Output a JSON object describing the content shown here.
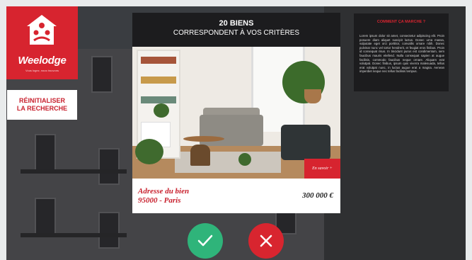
{
  "brand": {
    "name": "Weelodge",
    "tagline": "Vous logez, nous trouvons",
    "accent_color": "#d7242f",
    "house_icon": "house-people-icon"
  },
  "sidebar": {
    "reset_button": {
      "line1": "RÉINITIALISER",
      "line2": "LA RECHERCHE"
    }
  },
  "results": {
    "count_line": "20 BIENS",
    "criteria_line": "CORRESPONDENT À VOS CRITÈRES"
  },
  "listing": {
    "address_line1": "Adresse du bien",
    "address_line2": "95000 - Paris",
    "price": "300 000 €",
    "more_button": "En savoir +",
    "photo_icon": "living-room-photo"
  },
  "actions": {
    "accept_icon": "check-icon",
    "reject_icon": "close-icon",
    "accept_color": "#2fb47a",
    "reject_color": "#d8252f"
  },
  "info_panel": {
    "title": "COMMENT ÇA MARCHE ?",
    "body": "Lorem ipsum dolor sit amet, consectetur adipiscing elit. Proin posuere diam aliquet suscipit luctus. Donec urna massa, vulputate eget orci porttitor, convallis ornare nibh. Donec pulvinar nunc vel tortor hendrerit, et feugiat eros finibus. Proin id consequat risus. In tincidunt purus est condimentum, sem faucibus mauris eleifend. Nulla consequat sapien at augue facilisis, commodo faucibus neque ornare. Aliquam erat volutpat. Donec finibus, ipsum quis viverra malesuada, tellus erat volutpat nunc, in luctus augue erat a magna. Aenean imperdiet neque nec tellus facilisis tempus."
  }
}
